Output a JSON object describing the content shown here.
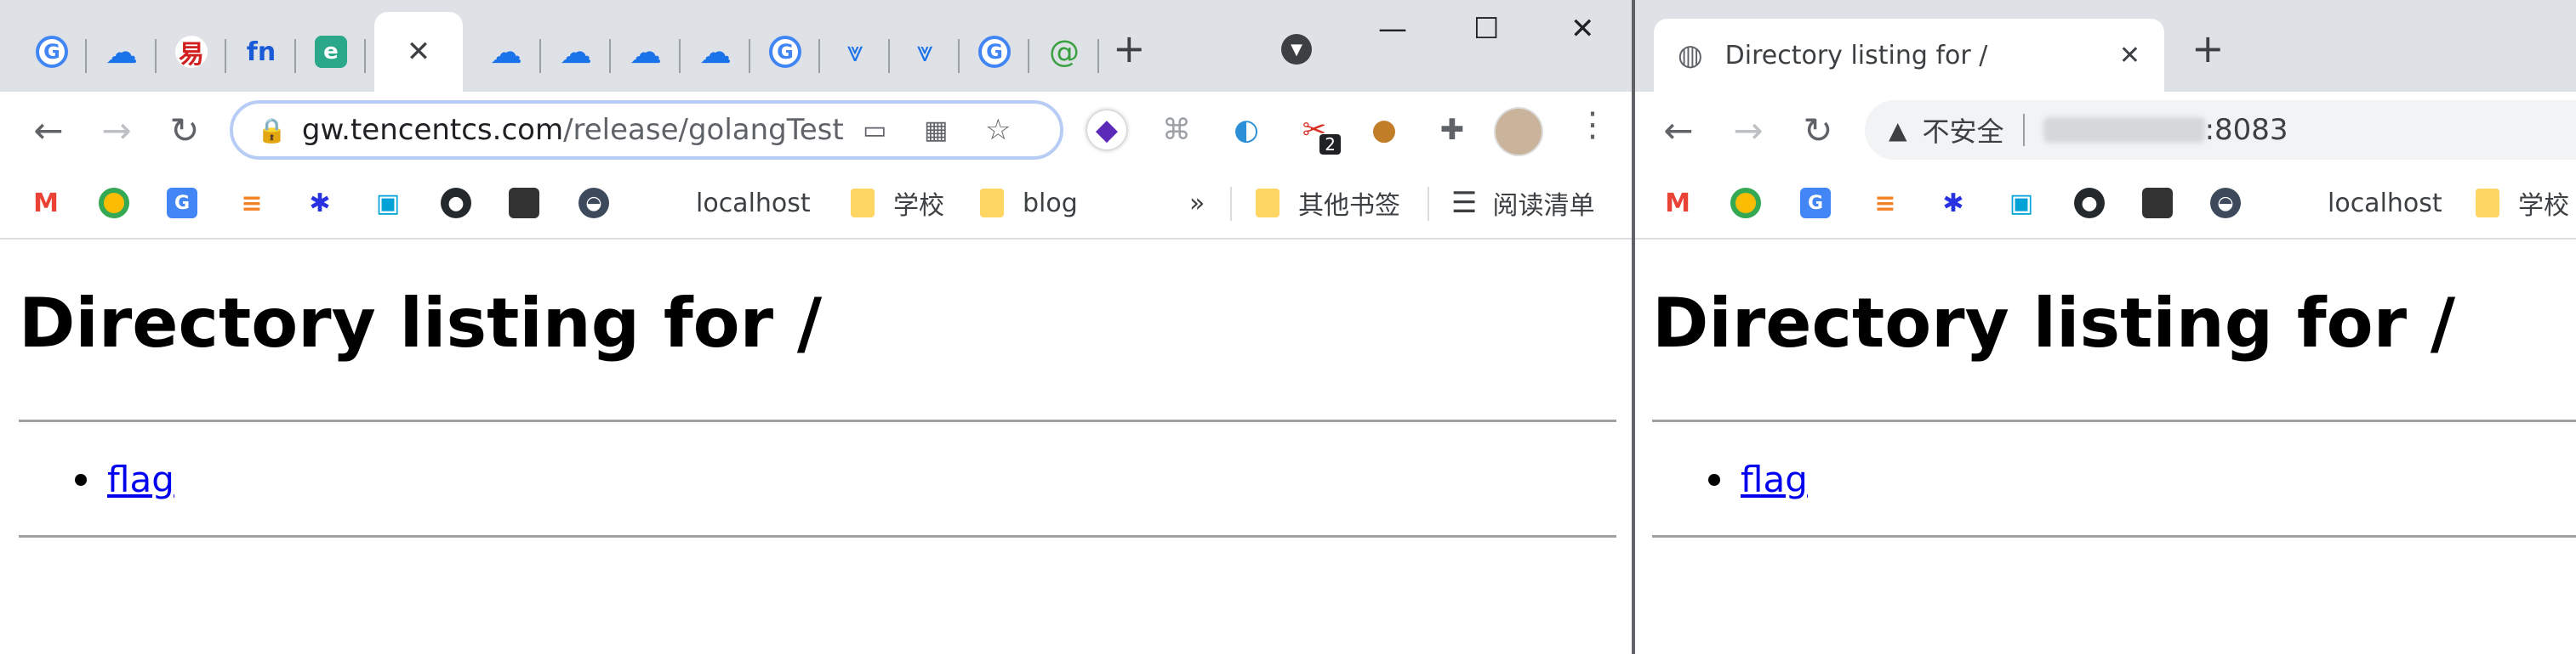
{
  "left_window": {
    "tabs": [
      {
        "icon": "google-icon"
      },
      {
        "icon": "cloud-icon"
      },
      {
        "icon": "red-logo-icon"
      },
      {
        "icon": "fn-icon"
      },
      {
        "icon": "green-app-icon"
      },
      {
        "icon": "close-icon",
        "active": true
      },
      {
        "icon": "cloud-icon"
      },
      {
        "icon": "cloud-icon"
      },
      {
        "icon": "cloud-icon"
      },
      {
        "icon": "cloud-icon"
      },
      {
        "icon": "google-icon"
      },
      {
        "icon": "download-icon"
      },
      {
        "icon": "download-icon"
      },
      {
        "icon": "google-icon"
      },
      {
        "icon": "green-swirl-icon"
      }
    ],
    "url": {
      "host": "gw.tencentcs.com",
      "path": "/release/golangTest"
    },
    "extension_badge": "2",
    "bookmarks": {
      "localhost": "localhost",
      "school": "学校",
      "blog": "blog",
      "overflow": "»",
      "other": "其他书签",
      "reading_list": "阅读清单"
    },
    "page": {
      "title": "Directory listing for /",
      "items": [
        "flag"
      ]
    }
  },
  "right_window": {
    "tab_title": "Directory listing for /",
    "security_label": "不安全",
    "url_port": ":8083",
    "bookmarks": {
      "localhost": "localhost",
      "school": "学校"
    },
    "page": {
      "title": "Directory listing for /",
      "items": [
        "flag"
      ]
    }
  },
  "colors": {
    "tabstrip": "#dee1e6",
    "link": "#0000ee",
    "omnibox_focus": "#b7cdf5"
  }
}
